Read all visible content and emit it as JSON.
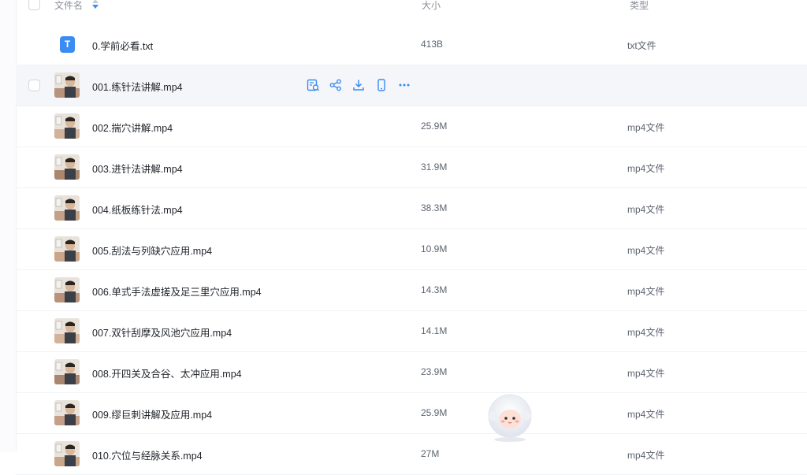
{
  "header": {
    "name_label": "文件名",
    "size_label": "大小",
    "type_label": "类型"
  },
  "files": [
    {
      "name": "0.学前必看.txt",
      "size": "413B",
      "type": "txt文件",
      "kind": "txt"
    },
    {
      "name": "001.练针法讲解.mp4",
      "size": "",
      "type": "",
      "kind": "video",
      "hover": true
    },
    {
      "name": "002.揣穴讲解.mp4",
      "size": "25.9M",
      "type": "mp4文件",
      "kind": "video"
    },
    {
      "name": "003.进针法讲解.mp4",
      "size": "31.9M",
      "type": "mp4文件",
      "kind": "video"
    },
    {
      "name": "004.纸板练针法.mp4",
      "size": "38.3M",
      "type": "mp4文件",
      "kind": "video"
    },
    {
      "name": "005.刮法与列缺穴应用.mp4",
      "size": "10.9M",
      "type": "mp4文件",
      "kind": "video"
    },
    {
      "name": "006.单式手法虚搓及足三里穴应用.mp4",
      "size": "14.3M",
      "type": "mp4文件",
      "kind": "video"
    },
    {
      "name": "007.双针刮摩及风池穴应用.mp4",
      "size": "14.1M",
      "type": "mp4文件",
      "kind": "video"
    },
    {
      "name": "008.开四关及合谷、太冲应用.mp4",
      "size": "23.9M",
      "type": "mp4文件",
      "kind": "video"
    },
    {
      "name": "009.缪巨刺讲解及应用.mp4",
      "size": "25.9M",
      "type": "mp4文件",
      "kind": "video"
    },
    {
      "name": "010.穴位与经脉关系.mp4",
      "size": "27M",
      "type": "mp4文件",
      "kind": "video"
    }
  ],
  "hover_actions": [
    "preview-icon",
    "share-icon",
    "download-icon",
    "phone-icon",
    "more-icon"
  ],
  "colors": {
    "accent": "#3a8bf2",
    "hover_row": "#f5f6f9"
  }
}
